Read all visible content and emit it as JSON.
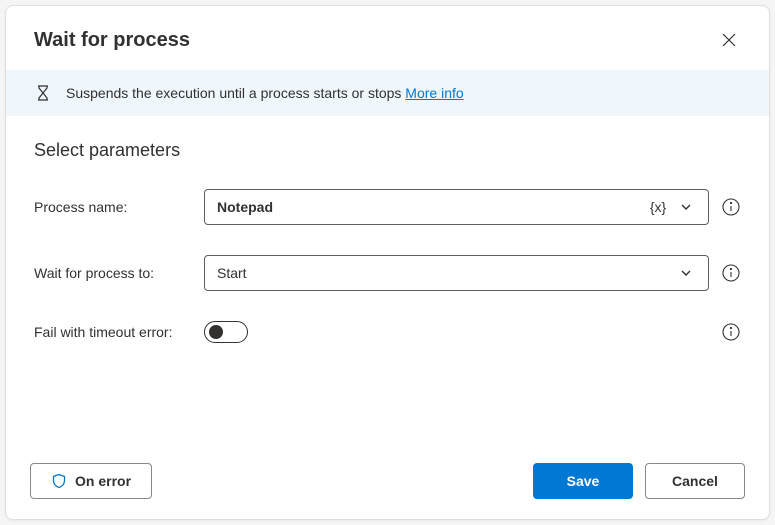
{
  "header": {
    "title": "Wait for process"
  },
  "info": {
    "description": "Suspends the execution until a process starts or stops",
    "linkText": "More info"
  },
  "section": {
    "title": "Select parameters"
  },
  "fields": {
    "processName": {
      "label": "Process name:",
      "value": "Notepad",
      "varSymbol": "{x}"
    },
    "waitFor": {
      "label": "Wait for process to:",
      "value": "Start"
    },
    "failTimeout": {
      "label": "Fail with timeout error:"
    }
  },
  "footer": {
    "onError": "On error",
    "save": "Save",
    "cancel": "Cancel"
  }
}
